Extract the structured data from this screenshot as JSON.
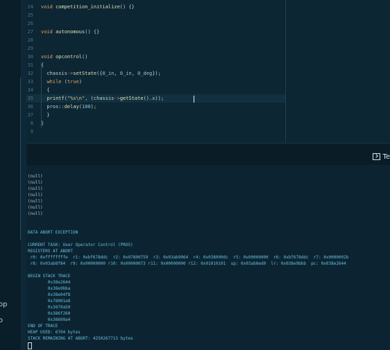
{
  "sidebar": {
    "labels": [
      "op",
      "o"
    ]
  },
  "editor": {
    "lines": [
      {
        "no": "24",
        "html": "<span class='kw'>void</span> <span class='fn'>competition_initialize</span>() {}"
      },
      {
        "no": "25",
        "html": ""
      },
      {
        "no": "26",
        "html": ""
      },
      {
        "no": "27",
        "html": "<span class='kw'>void</span> <span class='fn'>autonomous</span>() {}"
      },
      {
        "no": "28",
        "html": ""
      },
      {
        "no": "29",
        "html": ""
      },
      {
        "no": "30",
        "html": "<span class='kw'>void</span> <span class='fn'>opcontrol</span>()"
      },
      {
        "no": "31",
        "html": "{"
      },
      {
        "no": "32",
        "html": "  chassis<span class='ptr'>-&gt;</span><span class='fn'>setState</span>({<span class='num'>0_in</span>, <span class='num'>0_in</span>, <span class='num'>0_deg</span>});"
      },
      {
        "no": "33",
        "html": "  <span class='kw'>while</span> (<span class='kw'>true</span>)"
      },
      {
        "no": "34",
        "html": "  {"
      },
      {
        "no": "35",
        "html": "  <span class='fn'>printf</span>(<span class='str'>\"%s\\n\"</span>, (chassis<span class='ptr'>-&gt;</span><span class='fn'>getState</span>().x));"
      },
      {
        "no": "36",
        "html": "  pros::<span class='fn'>delay</span>(<span class='num'>100</span>);"
      },
      {
        "no": "37",
        "html": "  }"
      },
      {
        "no": "8",
        "html": "}"
      },
      {
        "no": "9",
        "html": ""
      }
    ]
  },
  "panel": {
    "terminal_tab_label": "Te"
  },
  "terminal": {
    "lines": [
      "(null)",
      "(null)",
      "(null)",
      "(null)",
      "(null)",
      "(null)",
      "(null)",
      "",
      "",
      "DATA ABORT EXCEPTION",
      "",
      "CURRENT TASK: User Operator Control (PROS)",
      "REGISTERS AT ABORT",
      " r0: 0xffffffffe  r1: 0xbf678ddc  r2: 0x07800759  r3: 0x03ab9064  r4: 0x038000dc  r5: 0x00000000  r6: 0xbf678ddc  r7: 0x0000002b",
      " r8: 0x03ab8f84  r9: 0x00000000 r10: 0x00000073 r11: 0x00000000 r12: 0x01010101  sp: 0x03ab8ed0  lr: 0x038e9bbb  pc: 0x038e2644",
      "",
      "BEGIN STACK TRACE",
      "        0x38e2644",
      "        0x38e9bba",
      "        0x38e04f8",
      "        0x78001e8",
      "        0x3870a50",
      "        0x386f260",
      "        0x38699a4",
      "END OF TRACE",
      "HEAP USED: 6704 bytes",
      "STACK REMAINING AT ABORT: 4250267713 bytes"
    ]
  }
}
